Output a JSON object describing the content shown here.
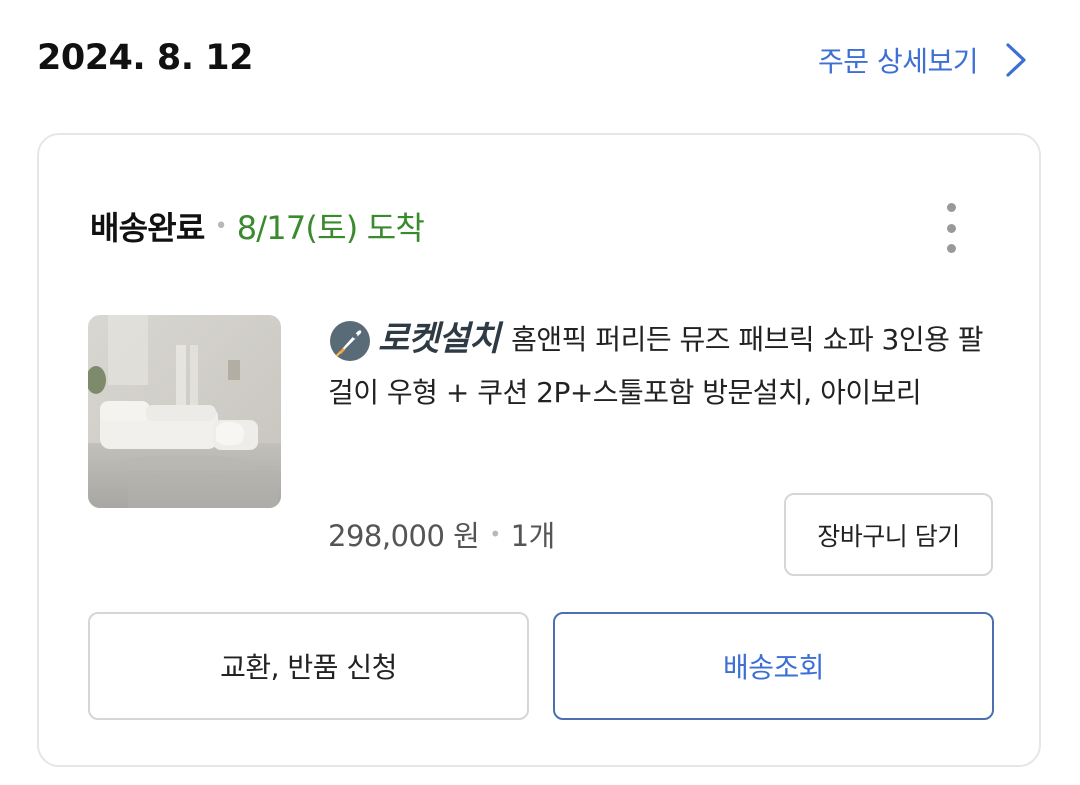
{
  "header": {
    "order_date": "2024. 8. 12",
    "detail_link_label": "주문 상세보기"
  },
  "order": {
    "status": "배송완료",
    "arrival": "8/17(토) 도착",
    "badge_label": "로켓설치",
    "product_name": "홈앤픽 퍼리든 뮤즈 패브릭 쇼파 3인용 팔걸이 우형 + 쿠션 2P+스툴포함 방문설치, 아이보리",
    "price": "298,000 원",
    "quantity": "1개",
    "cart_button_label": "장바구니 담기"
  },
  "actions": {
    "return_label": "교환, 반품 신청",
    "track_label": "배송조회"
  },
  "colors": {
    "accent_blue": "#3d6fd4",
    "arrival_green": "#3a8a2e",
    "track_border": "#4b70b0"
  },
  "icons": {
    "detail_arrow": "chevron-right-icon",
    "more_menu": "kebab-menu-icon",
    "rocket_badge": "rocket-icon"
  }
}
